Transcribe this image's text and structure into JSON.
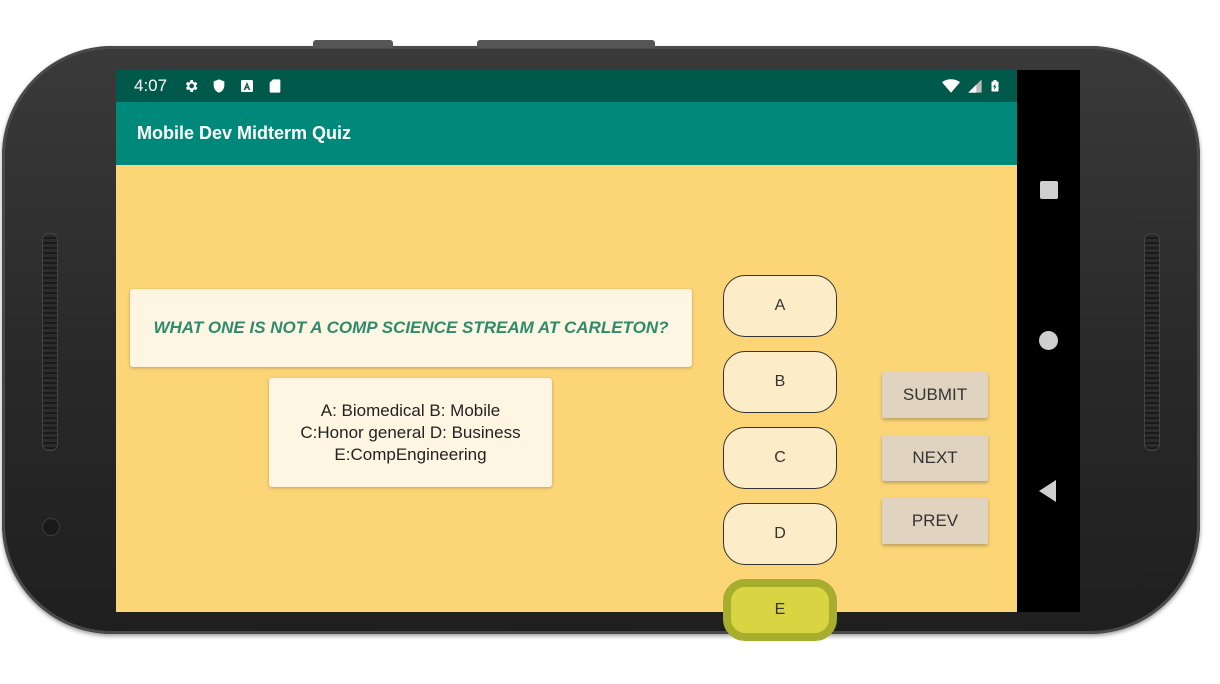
{
  "status_bar": {
    "time": "4:07",
    "left_icons": [
      "gear-icon",
      "shield-icon",
      "a-badge-icon",
      "sd-card-icon"
    ],
    "right_icons": [
      "wifi-icon",
      "signal-icon",
      "battery-icon"
    ]
  },
  "app_bar": {
    "title": "Mobile Dev Midterm Quiz"
  },
  "quiz": {
    "question": "WHAT ONE IS NOT A COMP SCIENCE STREAM AT CARLETON?",
    "options_lines": [
      "A: Biomedical B: Mobile",
      "C:Honor general D: Business",
      "E:CompEngineering"
    ]
  },
  "answers": [
    {
      "label": "A",
      "selected": false
    },
    {
      "label": "B",
      "selected": false
    },
    {
      "label": "C",
      "selected": false
    },
    {
      "label": "D",
      "selected": false
    },
    {
      "label": "E",
      "selected": true
    }
  ],
  "actions": {
    "submit": "SUBMIT",
    "next": "NEXT",
    "prev": "PREV"
  },
  "colors": {
    "status_bar": "#00594a",
    "app_bar": "#00897a",
    "background": "#fcd577",
    "question_text": "#2e8b6d",
    "selected_answer": "#d9d542"
  }
}
